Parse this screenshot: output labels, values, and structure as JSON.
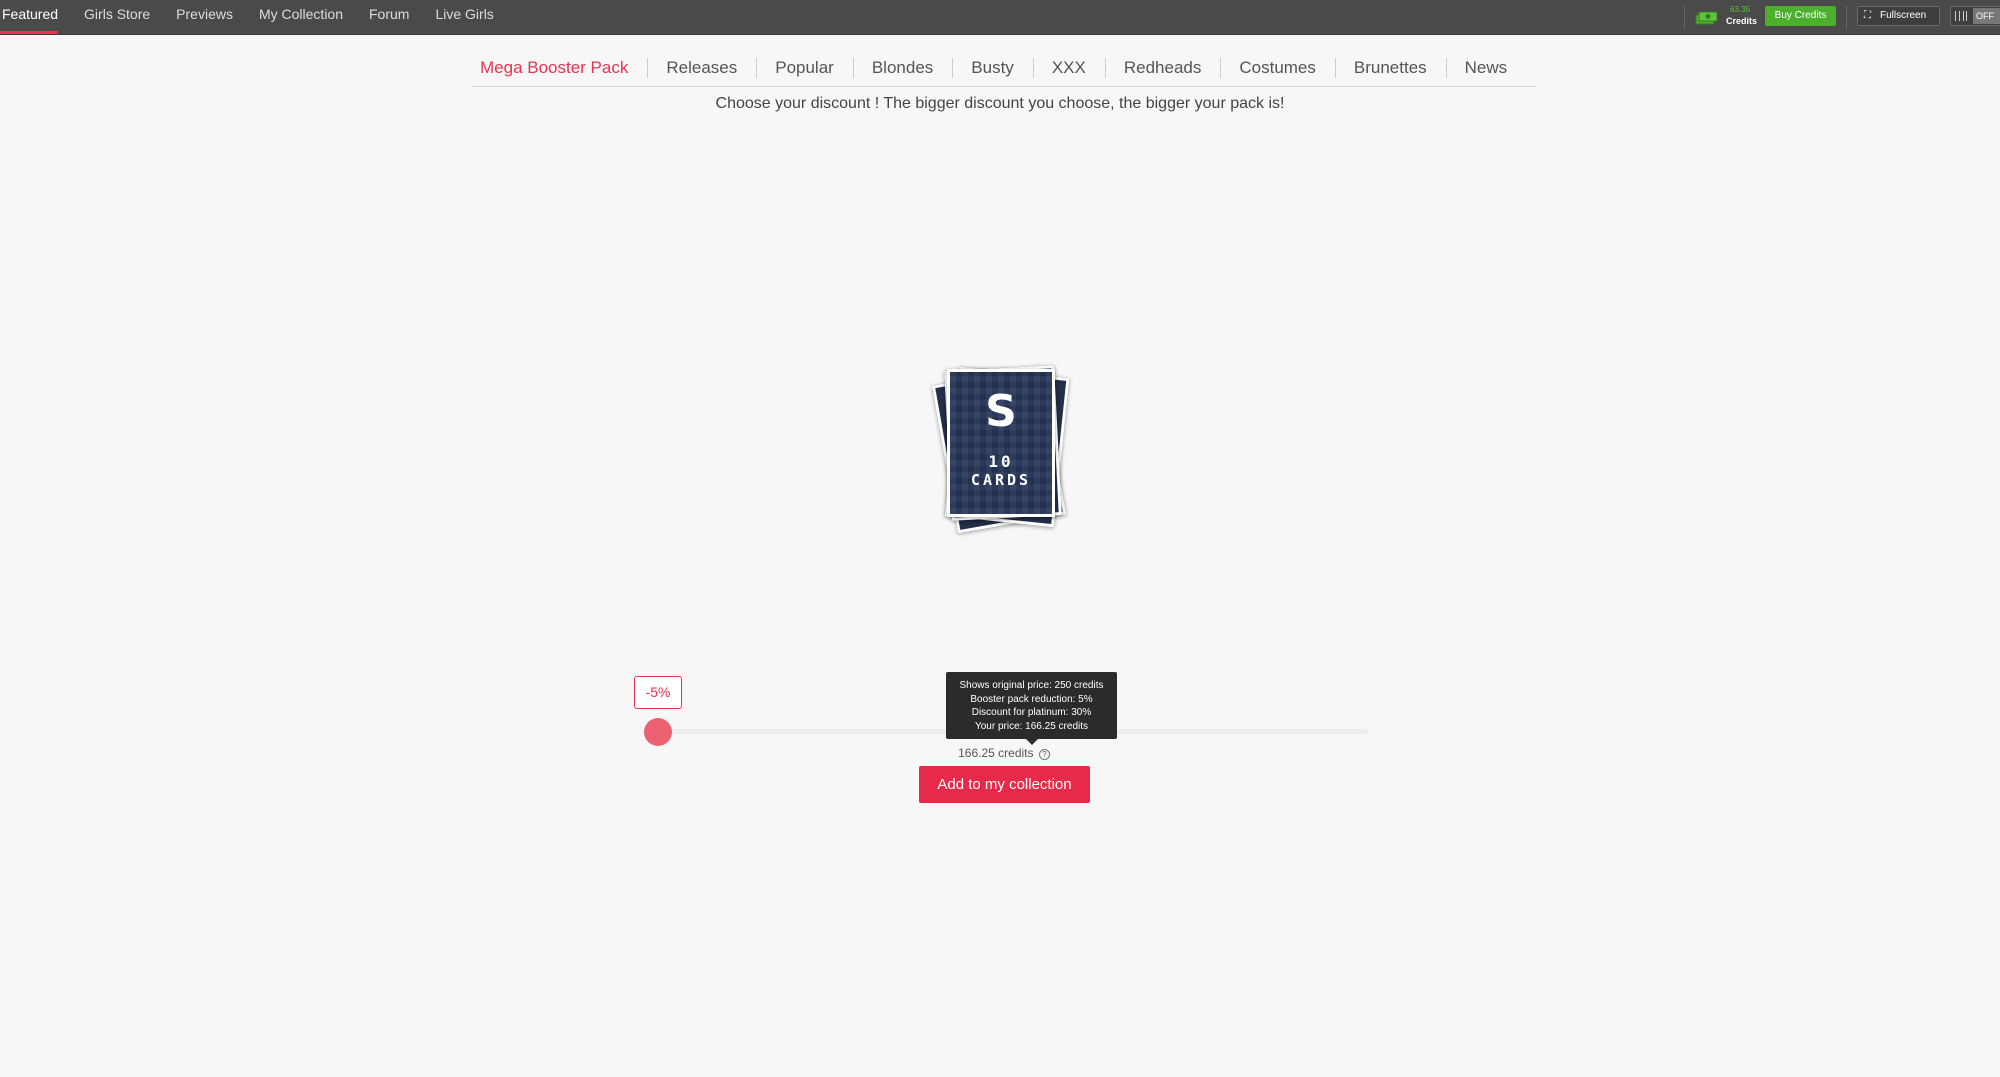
{
  "topnav": {
    "items": [
      {
        "label": "Featured",
        "active": true
      },
      {
        "label": "Girls Store"
      },
      {
        "label": "Previews"
      },
      {
        "label": "My Collection"
      },
      {
        "label": "Forum"
      },
      {
        "label": "Live Girls"
      }
    ]
  },
  "account": {
    "credits_amount": "63.35",
    "credits_label": "Credits",
    "buy_label": "Buy Credits",
    "fullscreen_label": "Fullscreen",
    "toggle_label": "OFF"
  },
  "categories": [
    {
      "label": "Mega Booster Pack",
      "active": true
    },
    {
      "label": "Releases"
    },
    {
      "label": "Popular"
    },
    {
      "label": "Blondes"
    },
    {
      "label": "Busty"
    },
    {
      "label": "XXX"
    },
    {
      "label": "Redheads"
    },
    {
      "label": "Costumes"
    },
    {
      "label": "Brunettes"
    },
    {
      "label": "News"
    }
  ],
  "subtitle": "Choose your discount ! The bigger discount you choose, the bigger your pack is!",
  "pack": {
    "logo": "S",
    "count": "10",
    "cards_word": "CARDS"
  },
  "slider": {
    "discount_label": "-5%",
    "value_fraction": 0.0
  },
  "tooltip": {
    "lines": [
      "Shows original price: 250 credits",
      "Booster pack reduction: 5%",
      "Discount for platinum: 30%",
      "Your price: 166.25 credits"
    ]
  },
  "price": {
    "text": "166.25 credits",
    "help_icon": "?"
  },
  "add_button": "Add to my collection",
  "colors": {
    "accent": "#e8344e",
    "buy_green": "#4caf2e",
    "topbar": "#4a4a4a"
  }
}
